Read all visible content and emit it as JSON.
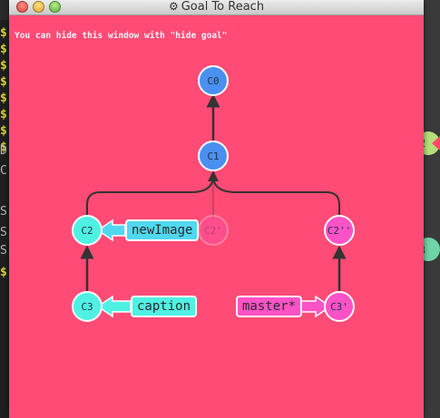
{
  "window": {
    "title": "Goal To Reach",
    "hint": "You can hide this window with \"hide goal\""
  },
  "commits": {
    "c0": "C0",
    "c1": "C1",
    "c2": "C2",
    "c2_ghost": "C2'",
    "c2pp": "C2''",
    "c3": "C3",
    "c3p": "C3'"
  },
  "branches": {
    "newImage": "newImage",
    "caption": "caption",
    "master": "master*"
  },
  "colors": {
    "background": "#ff4b75",
    "commit_blue": "#4a90f0",
    "commit_cyan": "#4ff1e3",
    "commit_pink": "#ff52c7",
    "tag_blue": "#50d8f0"
  },
  "terminal": {
    "glyphs": [
      "$",
      "$",
      "$",
      "$",
      "$",
      "$",
      "$",
      "$",
      "D",
      "C",
      "S",
      "S",
      "S",
      "$"
    ]
  },
  "background_graph": {
    "labels": [
      "2",
      "3"
    ]
  }
}
